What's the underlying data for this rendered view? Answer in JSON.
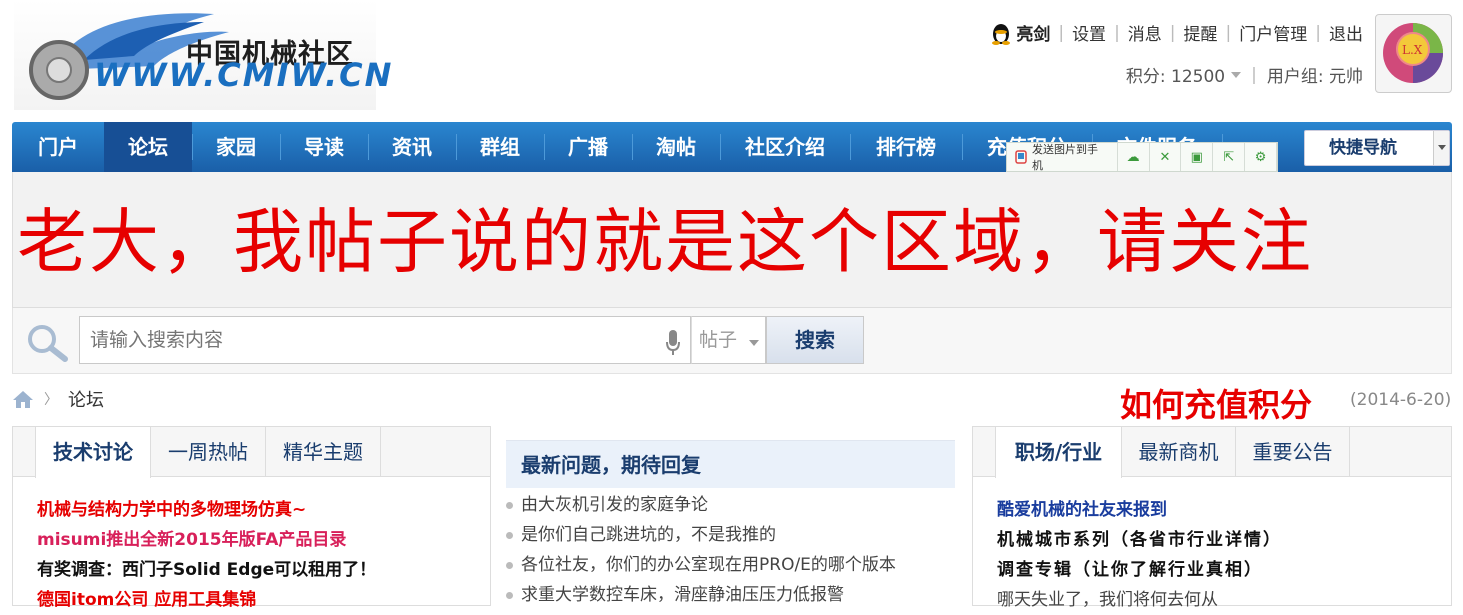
{
  "logo": {
    "cn": "中国机械社区",
    "url": "WWW.CMIW.CN"
  },
  "user": {
    "name": "亮剑",
    "links": [
      "设置",
      "消息",
      "提醒",
      "门户管理",
      "退出"
    ],
    "points_label": "积分: 12500",
    "group_label": "用户组: 元帅",
    "avatar_text": "L.X"
  },
  "nav": {
    "items": [
      "门户",
      "论坛",
      "家园",
      "导读",
      "资讯",
      "群组",
      "广播",
      "淘帖",
      "社区介绍",
      "排行榜",
      "充值积分",
      "文件服务"
    ],
    "active": "论坛",
    "quick_nav": "快捷导航"
  },
  "toolbar": {
    "send_label": "发送图片到手机"
  },
  "banner": {
    "text": "老大，我帖子说的就是这个区域，请关注"
  },
  "search": {
    "placeholder": "请输入搜索内容",
    "type": "帖子",
    "button": "搜索"
  },
  "breadcrumb": {
    "current": "论坛"
  },
  "headline": {
    "text": "如何充值积分",
    "date": "(2014-6-20)"
  },
  "left_panel": {
    "tabs": [
      "技术讨论",
      "一周热帖",
      "精华主题"
    ],
    "posts": [
      "机械与结构力学中的多物理场仿真~",
      "misumi推出全新2015年版FA产品目录",
      "有奖调查：西门子Solid Edge可以租用了！",
      "德国itom公司 应用工具集锦"
    ]
  },
  "middle_panel": {
    "title": "最新问题，期待回复",
    "items": [
      "由大灰机引发的家庭争论",
      "是你们自己跳进坑的，不是我推的",
      "各位社友，你们的办公室现在用PRO/E的哪个版本",
      "求重大学数控车床，滑座静油压压力低报警"
    ]
  },
  "right_panel": {
    "tabs": [
      "职场/行业",
      "最新商机",
      "重要公告"
    ],
    "posts": [
      "酷爱机械的社友来报到",
      "机械城市系列（各省市行业详情）",
      "调查专辑（让你了解行业真相）",
      "哪天失业了，我们将何去何从"
    ]
  },
  "colors": {
    "nav_bg": "#1f6fbd",
    "banner_red": "#e60000",
    "link_blue": "#1a3d6e"
  }
}
